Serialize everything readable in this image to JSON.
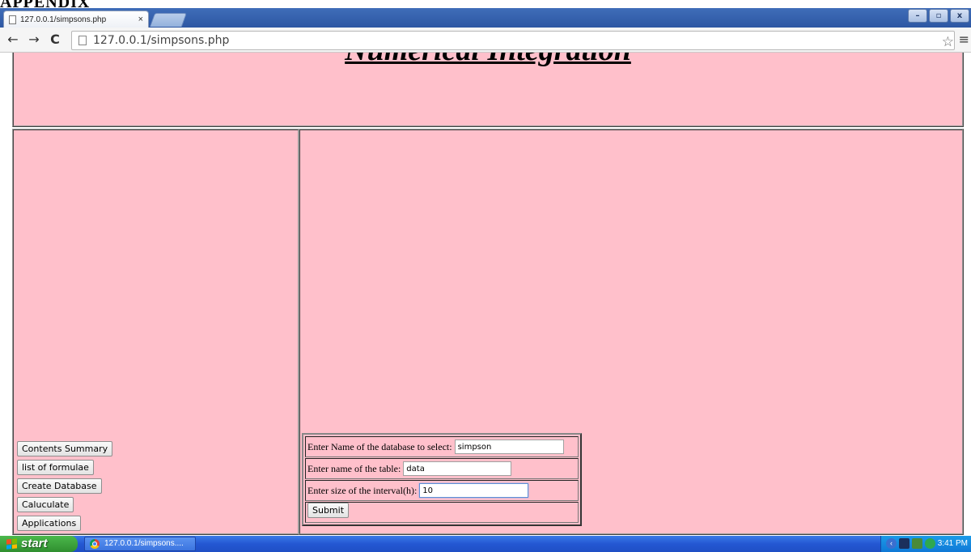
{
  "browser": {
    "tab_title": "127.0.0.1/simpsons.php",
    "tab_close": "×",
    "url": "127.0.0.1/simpsons.php",
    "window_buttons": [
      "–",
      "▫",
      "x"
    ]
  },
  "page": {
    "title": "Numerical Integration",
    "nav_buttons": [
      "Contents Summary",
      "list of formulae",
      "Create Database",
      "Caluculate",
      "Applications"
    ],
    "form": {
      "db_label": "Enter Name of the database to select:",
      "db_value": "simpson",
      "table_label": "Enter name of the table:",
      "table_value": "data",
      "interval_label": "Enter size of the interval(h):",
      "interval_value": "10",
      "submit_label": "Submit"
    }
  },
  "taskbar": {
    "start_label": "start",
    "task_label": "127.0.0.1/simpsons....",
    "clock": "3:41 PM"
  },
  "colors": {
    "page_background": "#ffc0cb",
    "taskbar": "#2457d2",
    "start_button": "#3aa33a"
  }
}
